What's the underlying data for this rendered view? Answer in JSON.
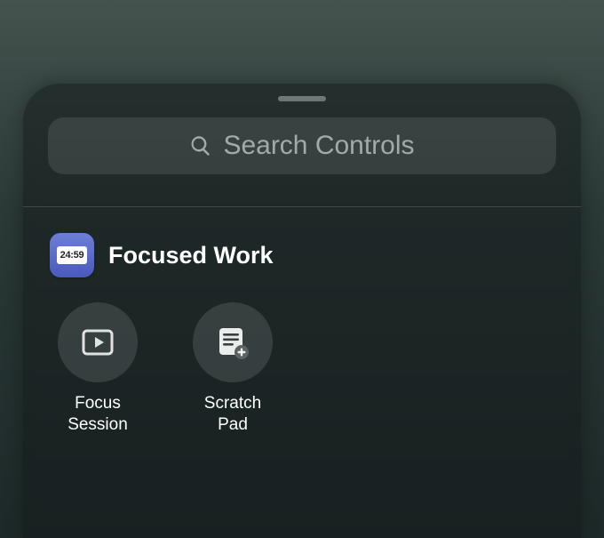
{
  "search": {
    "placeholder": "Search Controls"
  },
  "section": {
    "app_name": "Focused Work",
    "app_icon_text": "24:59",
    "controls": [
      {
        "label": "Focus\nSession"
      },
      {
        "label": "Scratch\nPad"
      }
    ]
  }
}
